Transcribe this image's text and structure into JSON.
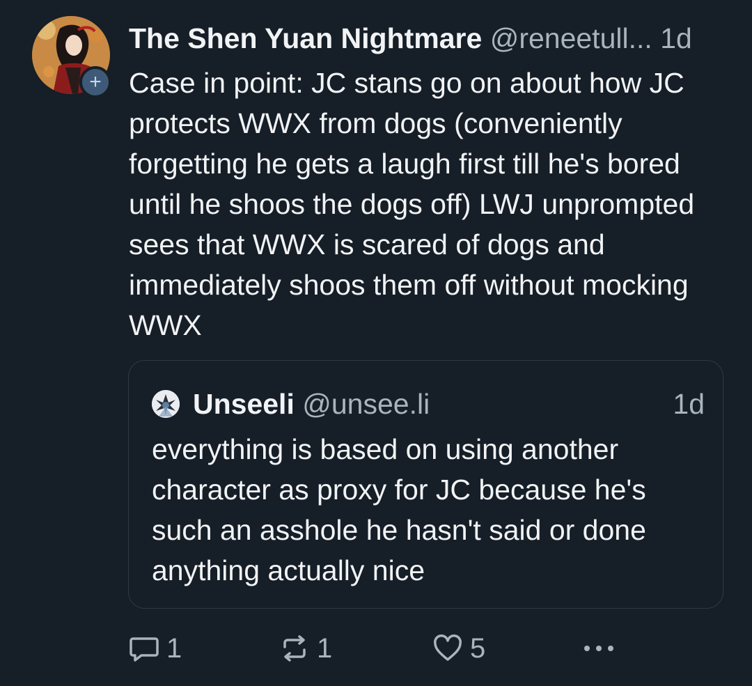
{
  "post": {
    "display_name": "The Shen Yuan Nightmare",
    "handle": "@reneetull...",
    "time": "1d",
    "text": "Case in point: JC stans go on about how JC protects WWX from dogs (conveniently forgetting he gets a laugh first till he's bored until he shoos the dogs off) LWJ unprompted sees that WWX is scared of dogs and immediately shoos them off without mocking WWX",
    "follow_badge": "+"
  },
  "quote": {
    "display_name": "Unseeli",
    "handle": "@unsee.li",
    "time": "1d",
    "text": "everything is based on using another character as proxy for JC because he's such an asshole he hasn't said or done anything actually nice"
  },
  "actions": {
    "reply_count": "1",
    "repost_count": "1",
    "like_count": "5",
    "icons": [
      "reply-icon",
      "repost-icon",
      "like-icon",
      "more-icon"
    ]
  },
  "colors": {
    "background": "#161e27",
    "text": "#f1f3f5",
    "muted": "#aab4be",
    "border": "#2e3a47",
    "badge": "#3e5a78"
  }
}
